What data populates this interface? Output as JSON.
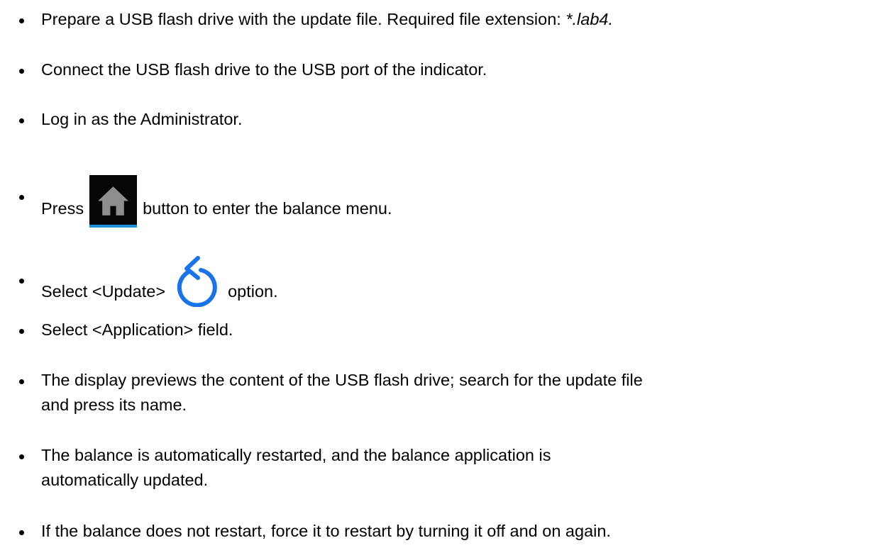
{
  "steps": [
    {
      "before": "Prepare a USB flash drive with the update file. Required file extension: ",
      "ext": "*.lab4."
    },
    {
      "text": "Connect the USB flash drive to the USB port of the indicator."
    },
    {
      "text": "Log in as the Administrator."
    },
    {
      "before": "Press",
      "after": "button to enter the balance menu.",
      "icon": "home-icon",
      "icon_bg": "#060606",
      "icon_accent": "#1d8fd9"
    },
    {
      "before": "Select <Update>",
      "after": "option.",
      "icon": "refresh-icon",
      "icon_color": "#1a73e8"
    },
    {
      "text": "Select <Application> field."
    },
    {
      "line1": "The display previews the content of the USB flash drive; search for the update file",
      "line2": "and press its name."
    },
    {
      "line1": "The balance is automatically restarted, and the balance application is",
      "line2": "automatically updated."
    },
    {
      "text": "If the balance does not restart, force it to restart by turning it off and on again."
    }
  ]
}
